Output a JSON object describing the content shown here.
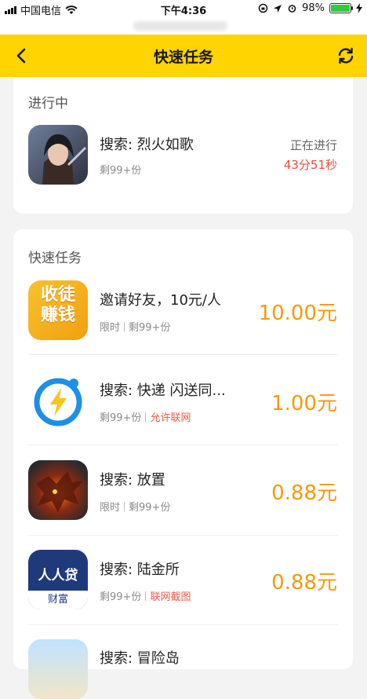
{
  "status_bar": {
    "carrier": "中国电信",
    "time": "下午4:36",
    "battery_percent": "98%",
    "battery_level": 0.98
  },
  "nav": {
    "title": "快速任务",
    "back_icon": "chevron-left-icon",
    "refresh_icon": "refresh-icon"
  },
  "in_progress": {
    "section_title": "进行中",
    "task": {
      "name": "搜索: 烈火如歌",
      "remaining": "剩99+份",
      "status": "正在进行",
      "countdown": "43分51秒"
    }
  },
  "quick_tasks": {
    "section_title": "快速任务",
    "items": [
      {
        "name": "邀请好友，10元/人",
        "tag": "限时",
        "remaining": "剩99+份",
        "price": "10.00元",
        "icon_text_1": "收徒",
        "icon_text_2": "赚钱"
      },
      {
        "name": "搜索: 快递 闪送同...",
        "remaining": "剩99+份",
        "tag": "允许联网",
        "price": "1.00元"
      },
      {
        "name": "搜索: 放置",
        "tag": "限时",
        "remaining": "剩99+份",
        "price": "0.88元"
      },
      {
        "name": "搜索: 陆金所",
        "remaining": "剩99+份",
        "tag": "联网截图",
        "price": "0.88元",
        "icon_text_1": "人人贷",
        "icon_text_2": "财富"
      },
      {
        "name": "搜索: 冒险岛"
      }
    ]
  },
  "colors": {
    "accent_yellow": "#ffd400",
    "price_orange": "#f59a0a",
    "countdown_red": "#f04a3a"
  }
}
